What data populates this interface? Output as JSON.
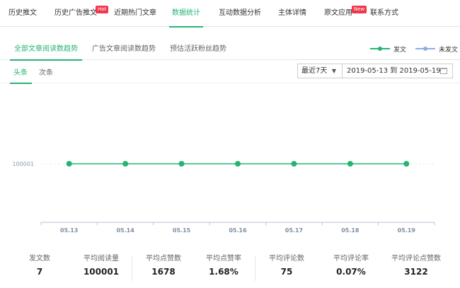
{
  "topnav": {
    "items": [
      {
        "label": "历史推文"
      },
      {
        "label": "历史广告推文",
        "badge": "Hot"
      },
      {
        "label": "近期热门文章"
      },
      {
        "label": "数据统计",
        "active": true
      },
      {
        "label": "互动数据分析"
      },
      {
        "label": "主体详情"
      },
      {
        "label": "原文应用",
        "badge": "New"
      },
      {
        "label": "联系方式"
      }
    ]
  },
  "subtabs": [
    {
      "label": "全部文章阅读数趋势",
      "active": true
    },
    {
      "label": "广告文章阅读数趋势"
    },
    {
      "label": "预估活跃粉丝趋势"
    }
  ],
  "legend": [
    {
      "label": "发文",
      "color": "#26b471"
    },
    {
      "label": "未发文",
      "color": "#8eaee0"
    }
  ],
  "tabs2": [
    {
      "label": "头条",
      "active": true
    },
    {
      "label": "次条"
    }
  ],
  "filter": {
    "range_label": "最近7天",
    "date_range": "2019-05-13 到 2019-05-19"
  },
  "chart_data": {
    "type": "line",
    "x": [
      "05.13",
      "05.14",
      "05.15",
      "05.16",
      "05.17",
      "05.18",
      "05.19"
    ],
    "series": [
      {
        "name": "发文",
        "values": [
          100001,
          100001,
          100001,
          100001,
          100001,
          100001,
          100001
        ],
        "color": "#26b471"
      }
    ],
    "ytick_labels": [
      "100001"
    ],
    "grid": true,
    "legend_position": "top-right"
  },
  "stats": [
    {
      "label": "发文数",
      "value": "7"
    },
    {
      "label": "平均阅读量",
      "value": "100001"
    },
    {
      "label": "平均点赞数",
      "value": "1678"
    },
    {
      "label": "平均点赞率",
      "value": "1.68%"
    },
    {
      "label": "平均评论数",
      "value": "75"
    },
    {
      "label": "平均评论率",
      "value": "0.07%"
    },
    {
      "label": "平均评论点赞数",
      "value": "3122"
    }
  ]
}
